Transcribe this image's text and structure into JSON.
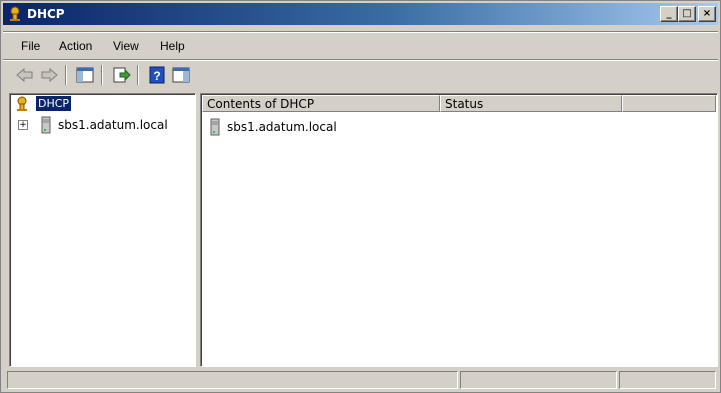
{
  "window": {
    "title": "DHCP"
  },
  "menu": {
    "items": [
      "File",
      "Action",
      "View",
      "Help"
    ]
  },
  "tree": {
    "root": {
      "label": "DHCP",
      "icon": "dhcp-icon"
    },
    "children": [
      {
        "label": "sbs1.adatum.local",
        "icon": "server-icon"
      }
    ]
  },
  "list": {
    "columns": [
      "Contents of DHCP",
      "Status",
      ""
    ],
    "rows": [
      {
        "name": "sbs1.adatum.local",
        "status": "",
        "icon": "server-icon"
      }
    ]
  },
  "toolbar": {
    "icons": [
      "back-arrow-icon",
      "forward-arrow-icon",
      "show-hide-tree-icon",
      "export-list-icon",
      "help-icon",
      "show-hide-action-pane-icon"
    ]
  },
  "colors": {
    "titlebar_start": "#0a246a",
    "titlebar_end": "#a6caf0",
    "selection": "#0a246a",
    "face": "#d4d0c8"
  }
}
